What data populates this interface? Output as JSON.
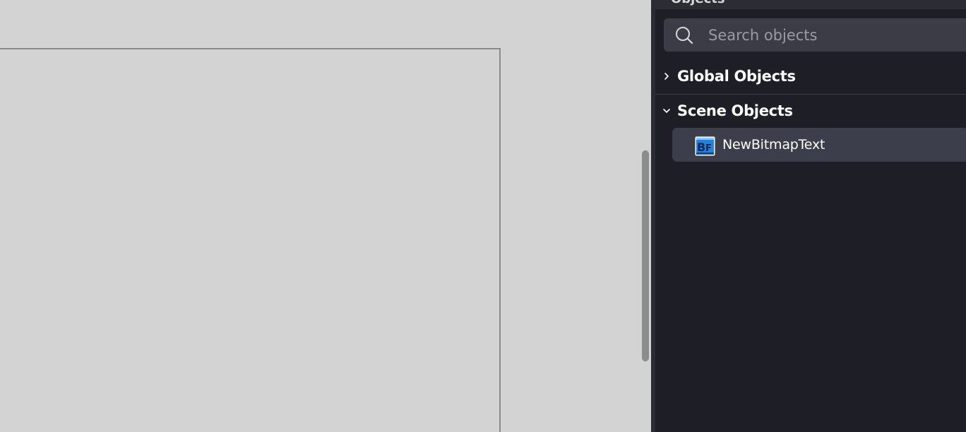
{
  "panel": {
    "header_title": "Objects",
    "search": {
      "placeholder": "Search objects",
      "value": "",
      "icon": "search-icon"
    },
    "groups": [
      {
        "label": "Global Objects",
        "expanded": false,
        "icon": "chevron-right-icon"
      },
      {
        "label": "Scene Objects",
        "expanded": true,
        "icon": "chevron-down-icon"
      }
    ],
    "scene_objects": [
      {
        "label": "NewBitmapText",
        "icon": "bitmap-text-icon",
        "selected": true
      }
    ]
  },
  "colors": {
    "canvas_background": "#d3d3d3",
    "scene_bounds": "#8a8a8a",
    "panel_background": "#1e1f26",
    "search_background": "#3b3c45",
    "selected_item_background": "#3c3f4b",
    "bitmap_icon_blue": "#1e6fc4"
  }
}
